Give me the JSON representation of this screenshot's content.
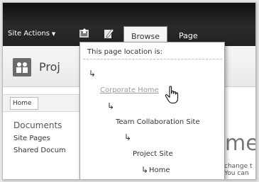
{
  "ribbon": {
    "site_actions_label": "Site Actions",
    "tabs": [
      {
        "label": "Browse",
        "selected": true
      },
      {
        "label": "Page",
        "selected": false
      }
    ]
  },
  "site": {
    "title": "Proj"
  },
  "topnav": {
    "home_label": "Home"
  },
  "quick_launch": {
    "heading": "Documents",
    "items": [
      "Site Pages",
      "Shared Docum"
    ]
  },
  "content": {
    "big_title": "me",
    "body_lines": [
      "change t",
      "You can"
    ]
  },
  "location_popup": {
    "header": "This page location is:",
    "breadcrumbs": [
      {
        "label": "Corporate Home",
        "link": true
      },
      {
        "label": "Team Collaboration Site",
        "link": false
      },
      {
        "label": "Project Site",
        "link": false
      },
      {
        "label": "Home",
        "link": false
      }
    ]
  },
  "colors": {
    "ribbon_bg": "#1a1a1a",
    "link_grey": "#9a9a9a"
  }
}
